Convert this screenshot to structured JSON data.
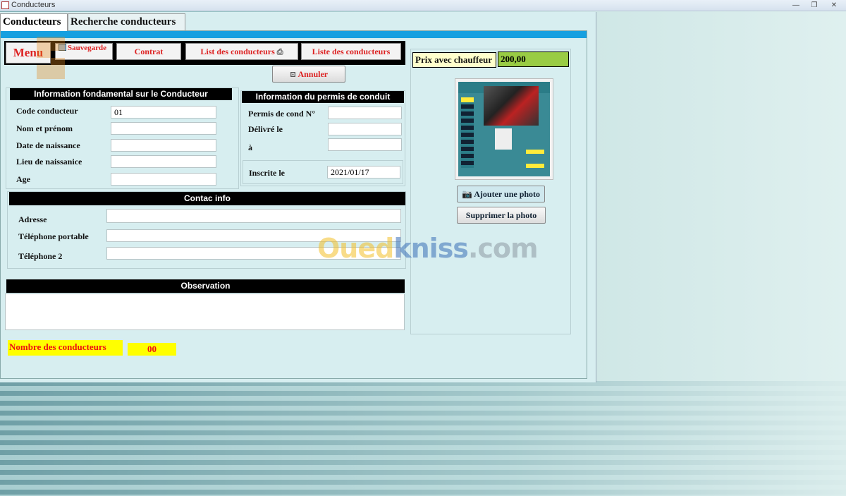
{
  "window": {
    "title": "Conducteurs"
  },
  "tabs": [
    {
      "label": "Conducteurs",
      "active": true
    },
    {
      "label": "Recherche conducteurs",
      "active": false
    }
  ],
  "toolbar": {
    "menu": "Menu",
    "sauvegarde": "Sauvegarde",
    "contrat": "Contrat",
    "list_conducteurs": "List des conducteurs",
    "liste_conducteurs": "Liste des conducteurs"
  },
  "annuler": "Annuler",
  "fundamental": {
    "header": "Information fondamental sur le Conducteur",
    "fields": [
      {
        "label": "Code conducteur",
        "value": "01"
      },
      {
        "label": "Nom et prénom",
        "value": ""
      },
      {
        "label": "Date de naissance",
        "value": ""
      },
      {
        "label": "Lieu de naissanice",
        "value": ""
      },
      {
        "label": "Age",
        "value": ""
      }
    ]
  },
  "permis": {
    "header": "Information du permis de conduit",
    "fields": [
      {
        "label": "Permis de cond N°",
        "value": ""
      },
      {
        "label": "Délivré le",
        "value": ""
      },
      {
        "label": "à",
        "value": ""
      }
    ],
    "inscrite_label": "Inscrite le",
    "inscrite_value": "2021/01/17"
  },
  "contact": {
    "header": "Contac info",
    "fields": [
      {
        "label": "Adresse",
        "value": ""
      },
      {
        "label": "Téléphone portable",
        "value": ""
      },
      {
        "label": "Téléphone 2",
        "value": ""
      }
    ]
  },
  "observation": {
    "header": "Observation",
    "value": ""
  },
  "count": {
    "label": "Nombre des conducteurs",
    "value": "00"
  },
  "prix": {
    "label": "Prix avec chauffeur",
    "value": "200,00"
  },
  "photo": {
    "add": "Ajouter une photo",
    "remove": "Supprimer la photo"
  },
  "watermark": {
    "part1": "Oued",
    "part2": "kniss",
    "part3": ".com"
  },
  "colors": {
    "accent_bar": "#16a0e0",
    "form_bg": "#d7eef0",
    "button_text": "#dd2222",
    "count_bg": "#ffff00",
    "prix_value_bg": "#99cc44"
  }
}
